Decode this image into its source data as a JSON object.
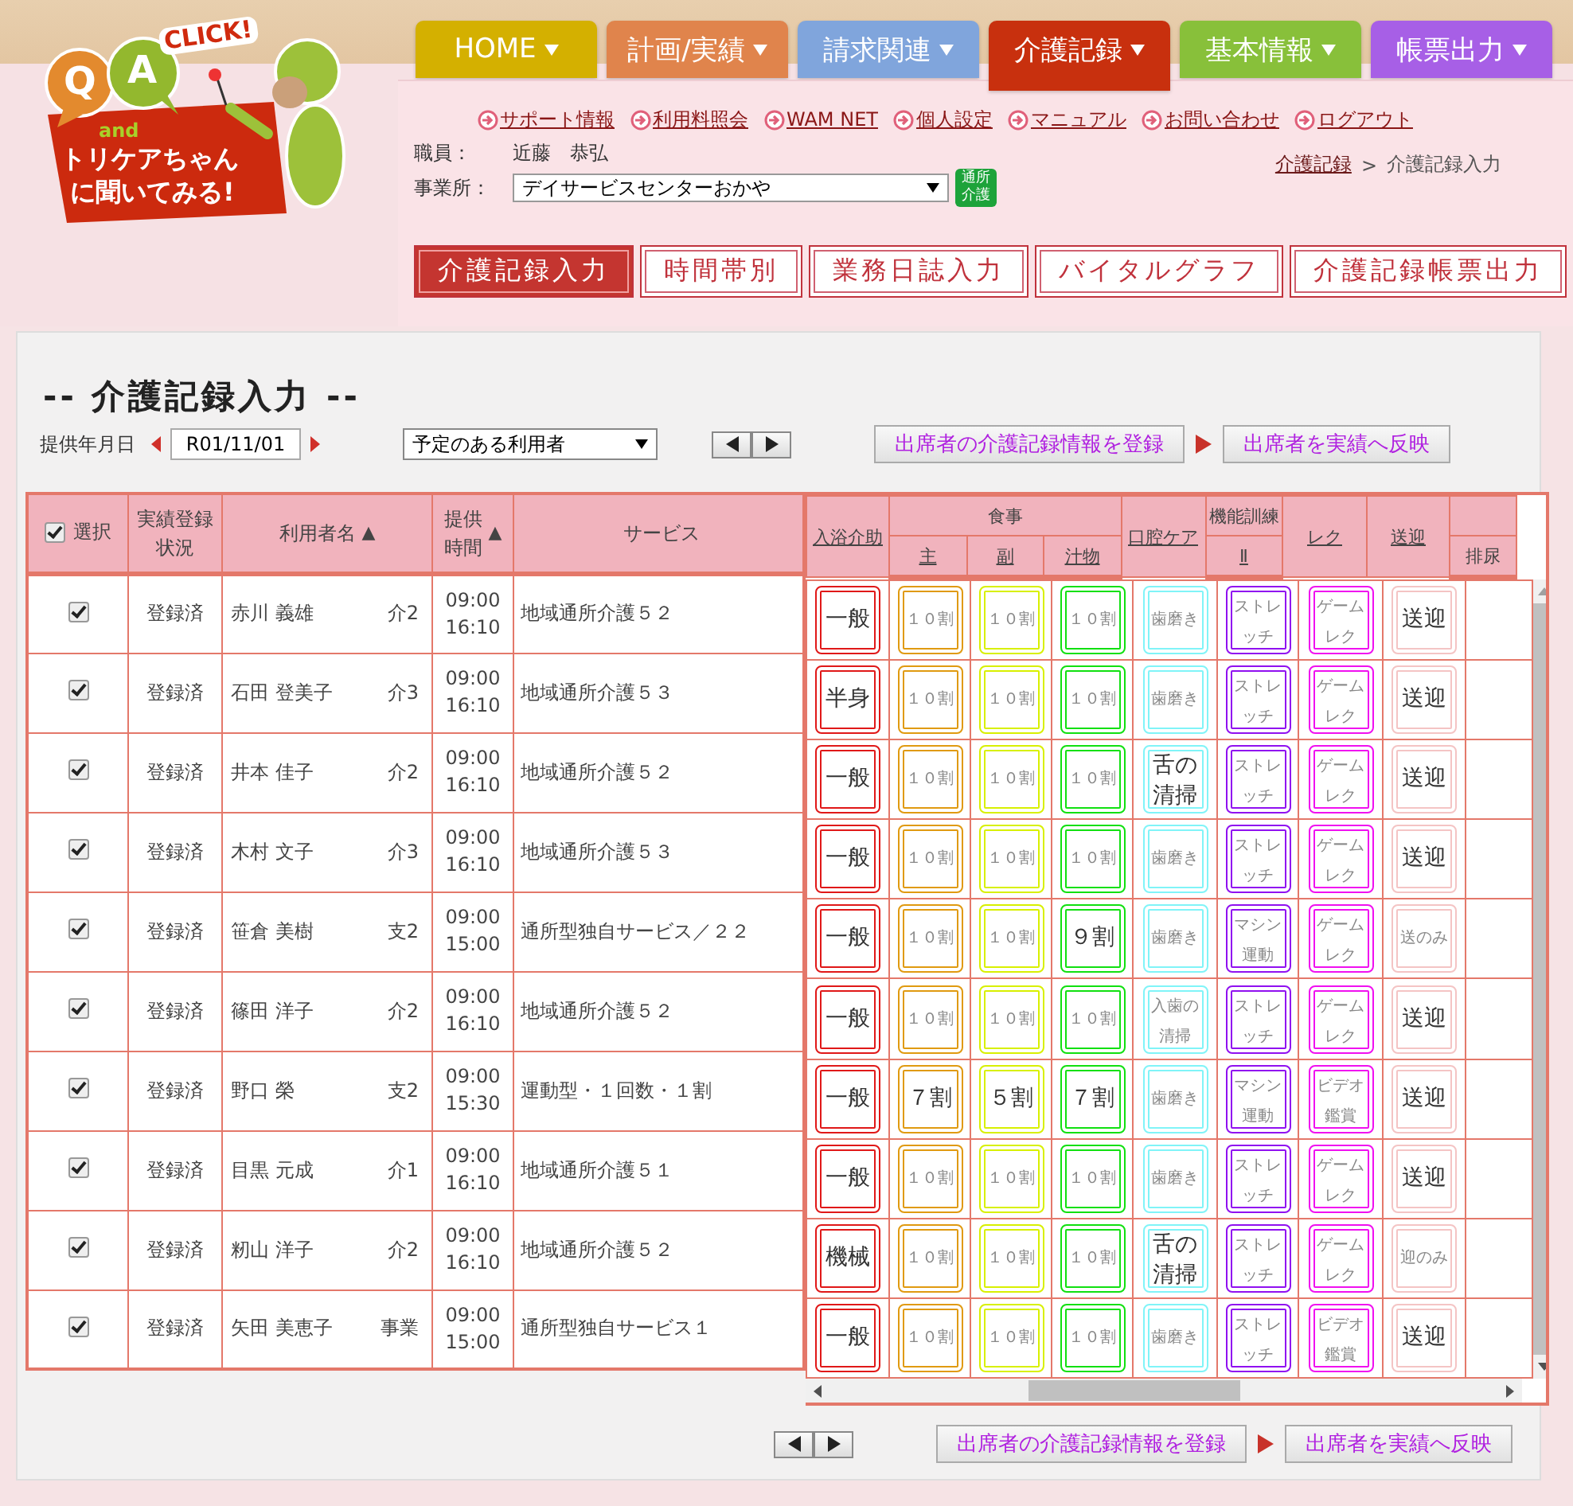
{
  "logo": {
    "q": "Q",
    "a": "A",
    "click": "CLICK!",
    "and": "and",
    "line1": "トリケアちゃん",
    "line2": "に聞いてみる!"
  },
  "nav_tabs": [
    {
      "label": "HOME",
      "color": "#d4b000",
      "selected": false
    },
    {
      "label": "計画/実績",
      "color": "#e0844c",
      "selected": false
    },
    {
      "label": "請求関連",
      "color": "#80a5dc",
      "selected": false
    },
    {
      "label": "介護記録",
      "color": "#c8300e",
      "selected": true
    },
    {
      "label": "基本情報",
      "color": "#88c03a",
      "selected": false
    },
    {
      "label": "帳票出力",
      "color": "#a75fe6",
      "selected": false
    }
  ],
  "links": [
    "サポート情報",
    "利用料照会",
    "WAM NET",
    "個人設定",
    "マニュアル",
    "お問い合わせ",
    "ログアウト"
  ],
  "staff": {
    "label": "職員：",
    "value": "近藤　恭弘"
  },
  "office": {
    "label": "事業所：",
    "value": "デイサービスセンターおかや",
    "badge": "通所介護"
  },
  "breadcrumb": [
    {
      "label": "介護記録",
      "link": true
    },
    {
      "label": "介護記録入力",
      "link": false
    }
  ],
  "breadcrumb_separator": ">",
  "sub_tabs": [
    {
      "label": "介護記録入力",
      "selected": true
    },
    {
      "label": "時間帯別",
      "selected": false
    },
    {
      "label": "業務日誌入力",
      "selected": false
    },
    {
      "label": "バイタルグラフ",
      "selected": false
    },
    {
      "label": "介護記録帳票出力",
      "selected": false
    }
  ],
  "title": "-- 介護記録入力 --",
  "date": {
    "label": "提供年月日",
    "value": "R01/11/01"
  },
  "filter": {
    "value": "予定のある利用者"
  },
  "top_actions": [
    "出席者の介護記録情報を登録",
    "出席者を実績へ反映"
  ],
  "bottom_actions": [
    "出席者の介護記録情報を登録",
    "出席者を実績へ反映"
  ],
  "table": {
    "select_all": {
      "label": "選択",
      "checked": true
    },
    "left_columns": [
      {
        "lines": [
          "実績登録",
          "状況"
        ]
      },
      {
        "lines": [
          "利用者名"
        ],
        "sort_mark": "▲"
      },
      {
        "lines": [
          "提供",
          "時間"
        ],
        "sort_mark": "▲"
      },
      {
        "lines": [
          "サービス"
        ]
      }
    ],
    "right_columns": [
      {
        "label": "入浴介助",
        "link": true,
        "color": "#e01818"
      },
      {
        "group": "食事",
        "children": [
          {
            "label": "主",
            "link": true,
            "color": "#e09a10"
          },
          {
            "label": "副",
            "link": true,
            "color": "#d8f000"
          },
          {
            "label": "汁物",
            "link": true,
            "color": "#10e010"
          }
        ]
      },
      {
        "label": "口腔ケア",
        "link": true,
        "color": "#80f4f8"
      },
      {
        "group": "機能訓練",
        "children": [
          {
            "label": "Ⅱ",
            "link": true,
            "color": "#9010f0"
          }
        ]
      },
      {
        "label": "レク",
        "link": true,
        "color": "#f010f0"
      },
      {
        "label": "送迎",
        "link": true,
        "color": "#f4c4c4"
      },
      {
        "split": true,
        "label": "排尿",
        "link": false
      }
    ],
    "rows": [
      {
        "selected": true,
        "status": "登録済",
        "name": "赤川 義雄",
        "care_level": "介2",
        "start": "09:00",
        "end": "16:10",
        "service": "地域通所介護５２",
        "cells": [
          {
            "value": "一般",
            "faded": false
          },
          {
            "value": "１０割",
            "faded": true
          },
          {
            "value": "１０割",
            "faded": true
          },
          {
            "value": "１０割",
            "faded": true
          },
          {
            "value": "歯磨き",
            "faded": true
          },
          {
            "value": "ストレッチ",
            "faded": true
          },
          {
            "value": "ゲームレク",
            "faded": true
          },
          {
            "value": "送迎",
            "faded": false
          }
        ]
      },
      {
        "selected": true,
        "status": "登録済",
        "name": "石田 登美子",
        "care_level": "介3",
        "start": "09:00",
        "end": "16:10",
        "service": "地域通所介護５３",
        "cells": [
          {
            "value": "半身",
            "faded": false
          },
          {
            "value": "１０割",
            "faded": true
          },
          {
            "value": "１０割",
            "faded": true
          },
          {
            "value": "１０割",
            "faded": true
          },
          {
            "value": "歯磨き",
            "faded": true
          },
          {
            "value": "ストレッチ",
            "faded": true
          },
          {
            "value": "ゲームレク",
            "faded": true
          },
          {
            "value": "送迎",
            "faded": false
          }
        ]
      },
      {
        "selected": true,
        "status": "登録済",
        "name": "井本 佳子",
        "care_level": "介2",
        "start": "09:00",
        "end": "16:10",
        "service": "地域通所介護５２",
        "cells": [
          {
            "value": "一般",
            "faded": false
          },
          {
            "value": "１０割",
            "faded": true
          },
          {
            "value": "１０割",
            "faded": true
          },
          {
            "value": "１０割",
            "faded": true
          },
          {
            "value": "舌の清掃",
            "faded": false
          },
          {
            "value": "ストレッチ",
            "faded": true
          },
          {
            "value": "ゲームレク",
            "faded": true
          },
          {
            "value": "送迎",
            "faded": false
          }
        ]
      },
      {
        "selected": true,
        "status": "登録済",
        "name": "木村 文子",
        "care_level": "介3",
        "start": "09:00",
        "end": "16:10",
        "service": "地域通所介護５３",
        "cells": [
          {
            "value": "一般",
            "faded": false
          },
          {
            "value": "１０割",
            "faded": true
          },
          {
            "value": "１０割",
            "faded": true
          },
          {
            "value": "１０割",
            "faded": true
          },
          {
            "value": "歯磨き",
            "faded": true
          },
          {
            "value": "ストレッチ",
            "faded": true
          },
          {
            "value": "ゲームレク",
            "faded": true
          },
          {
            "value": "送迎",
            "faded": false
          }
        ]
      },
      {
        "selected": true,
        "status": "登録済",
        "name": "笹倉 美樹",
        "care_level": "支2",
        "start": "09:00",
        "end": "15:00",
        "service": "通所型独自サービス／２２",
        "cells": [
          {
            "value": "一般",
            "faded": false
          },
          {
            "value": "１０割",
            "faded": true
          },
          {
            "value": "１０割",
            "faded": true
          },
          {
            "value": "９割",
            "faded": false
          },
          {
            "value": "歯磨き",
            "faded": true
          },
          {
            "value": "マシン運動",
            "faded": true
          },
          {
            "value": "ゲームレク",
            "faded": true
          },
          {
            "value": "送のみ",
            "faded": true
          }
        ]
      },
      {
        "selected": true,
        "status": "登録済",
        "name": "篠田 洋子",
        "care_level": "介2",
        "start": "09:00",
        "end": "16:10",
        "service": "地域通所介護５２",
        "cells": [
          {
            "value": "一般",
            "faded": false
          },
          {
            "value": "１０割",
            "faded": true
          },
          {
            "value": "１０割",
            "faded": true
          },
          {
            "value": "１０割",
            "faded": true
          },
          {
            "value": "入歯の清掃",
            "faded": true
          },
          {
            "value": "ストレッチ",
            "faded": true
          },
          {
            "value": "ゲームレク",
            "faded": true
          },
          {
            "value": "送迎",
            "faded": false
          }
        ]
      },
      {
        "selected": true,
        "status": "登録済",
        "name": "野口 榮",
        "care_level": "支2",
        "start": "09:00",
        "end": "15:30",
        "service": "運動型・１回数・１割",
        "cells": [
          {
            "value": "一般",
            "faded": false
          },
          {
            "value": "７割",
            "faded": false
          },
          {
            "value": "５割",
            "faded": false
          },
          {
            "value": "７割",
            "faded": false
          },
          {
            "value": "歯磨き",
            "faded": true
          },
          {
            "value": "マシン運動",
            "faded": true
          },
          {
            "value": "ビデオ鑑賞",
            "faded": true
          },
          {
            "value": "送迎",
            "faded": false
          }
        ]
      },
      {
        "selected": true,
        "status": "登録済",
        "name": "目黒 元成",
        "care_level": "介1",
        "start": "09:00",
        "end": "16:10",
        "service": "地域通所介護５１",
        "cells": [
          {
            "value": "一般",
            "faded": false
          },
          {
            "value": "１０割",
            "faded": true
          },
          {
            "value": "１０割",
            "faded": true
          },
          {
            "value": "１０割",
            "faded": true
          },
          {
            "value": "歯磨き",
            "faded": true
          },
          {
            "value": "ストレッチ",
            "faded": true
          },
          {
            "value": "ゲームレク",
            "faded": true
          },
          {
            "value": "送迎",
            "faded": false
          }
        ]
      },
      {
        "selected": true,
        "status": "登録済",
        "name": "籾山 洋子",
        "care_level": "介2",
        "start": "09:00",
        "end": "16:10",
        "service": "地域通所介護５２",
        "cells": [
          {
            "value": "機械",
            "faded": false
          },
          {
            "value": "１０割",
            "faded": true
          },
          {
            "value": "１０割",
            "faded": true
          },
          {
            "value": "１０割",
            "faded": true
          },
          {
            "value": "舌の清掃",
            "faded": false
          },
          {
            "value": "ストレッチ",
            "faded": true
          },
          {
            "value": "ゲームレク",
            "faded": true
          },
          {
            "value": "迎のみ",
            "faded": true
          }
        ]
      },
      {
        "selected": true,
        "status": "登録済",
        "name": "矢田 美恵子",
        "care_level": "事業",
        "start": "09:00",
        "end": "15:00",
        "service": "通所型独自サービス１",
        "cells": [
          {
            "value": "一般",
            "faded": false
          },
          {
            "value": "１０割",
            "faded": true
          },
          {
            "value": "１０割",
            "faded": true
          },
          {
            "value": "１０割",
            "faded": true
          },
          {
            "value": "歯磨き",
            "faded": true
          },
          {
            "value": "ストレッチ",
            "faded": true
          },
          {
            "value": "ビデオ鑑賞",
            "faded": true
          },
          {
            "value": "送迎",
            "faded": false
          }
        ]
      }
    ]
  }
}
